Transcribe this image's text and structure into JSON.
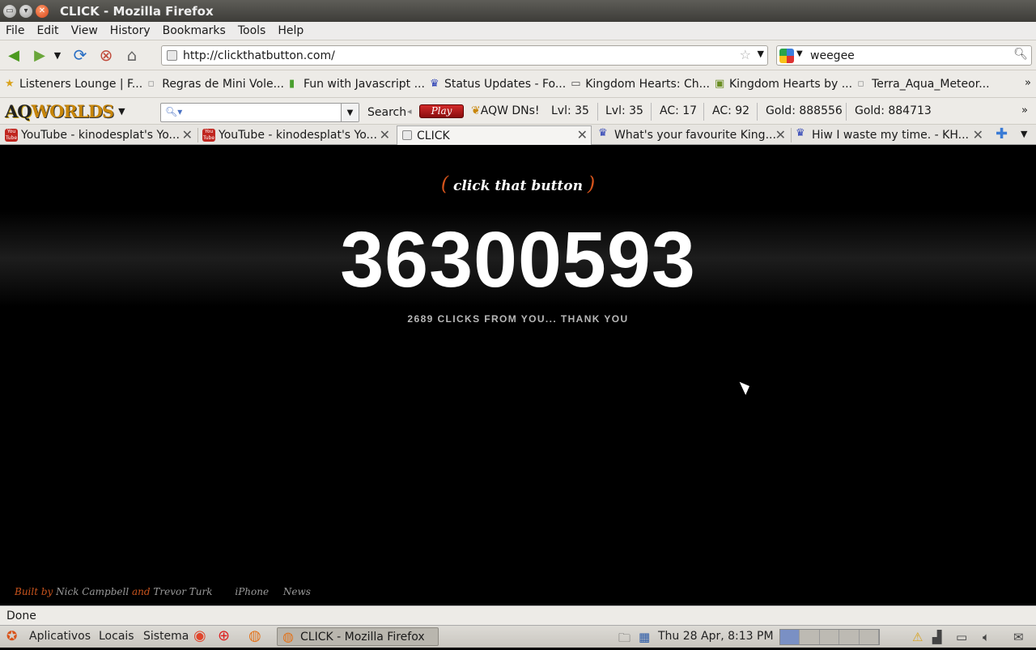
{
  "window": {
    "title": "CLICK - Mozilla Firefox"
  },
  "menu": [
    "File",
    "Edit",
    "View",
    "History",
    "Bookmarks",
    "Tools",
    "Help"
  ],
  "nav": {
    "url": "http://clickthatbutton.com/",
    "search_value": "weegee"
  },
  "bookmarks": [
    {
      "label": "Listeners Lounge | F...",
      "icon": "star-icon",
      "color": "#d9a21b"
    },
    {
      "label": "Regras de Mini Vole...",
      "icon": "page-icon",
      "color": "#9a9a9a"
    },
    {
      "label": "Fun with Javascript ...",
      "icon": "bars-icon",
      "color": "#4a9f2f"
    },
    {
      "label": "Status Updates - Fo...",
      "icon": "crown-icon",
      "color": "#2a3fb5"
    },
    {
      "label": "Kingdom Hearts: Ch...",
      "icon": "card-icon",
      "color": "#555555"
    },
    {
      "label": "Kingdom Hearts by ...",
      "icon": "doc-icon",
      "color": "#6b8e23"
    },
    {
      "label": "Terra_Aqua_Meteor...",
      "icon": "page-icon",
      "color": "#9a9a9a"
    }
  ],
  "aq_toolbar": {
    "logo_a": "AQ",
    "logo_b": "WORLDS",
    "search_label": "Search",
    "play_label": "Play",
    "dns_label": "AQW DNs!",
    "items": [
      "Lvl: 35",
      "Lvl: 35",
      "AC: 17",
      "AC: 92",
      "Gold: 888556",
      "Gold: 884713"
    ]
  },
  "tabs": [
    {
      "label": "YouTube - kinodesplat's Yo...",
      "icon": "youtube-icon"
    },
    {
      "label": "YouTube - kinodesplat's Yo...",
      "icon": "youtube-icon"
    },
    {
      "label": "CLICK",
      "icon": "page-icon",
      "active": true
    },
    {
      "label": "What's your favourite King...",
      "icon": "crown-icon"
    },
    {
      "label": "Hiw I waste my time. - KH...",
      "icon": "crown-icon"
    }
  ],
  "page": {
    "brand": "click that button",
    "counter": "36300593",
    "subtext": "2689 CLICKS FROM YOU... THANK YOU",
    "footer": {
      "built_by": "Built by",
      "author1": "Nick Campbell",
      "and": "and",
      "author2": "Trevor Turk",
      "link1": "iPhone",
      "link2": "News"
    }
  },
  "status": "Done",
  "panel": {
    "apps": "Aplicativos",
    "places": "Locais",
    "system": "Sistema",
    "task": "CLICK - Mozilla Firefox",
    "clock": "Thu 28 Apr,  8:13 PM"
  }
}
